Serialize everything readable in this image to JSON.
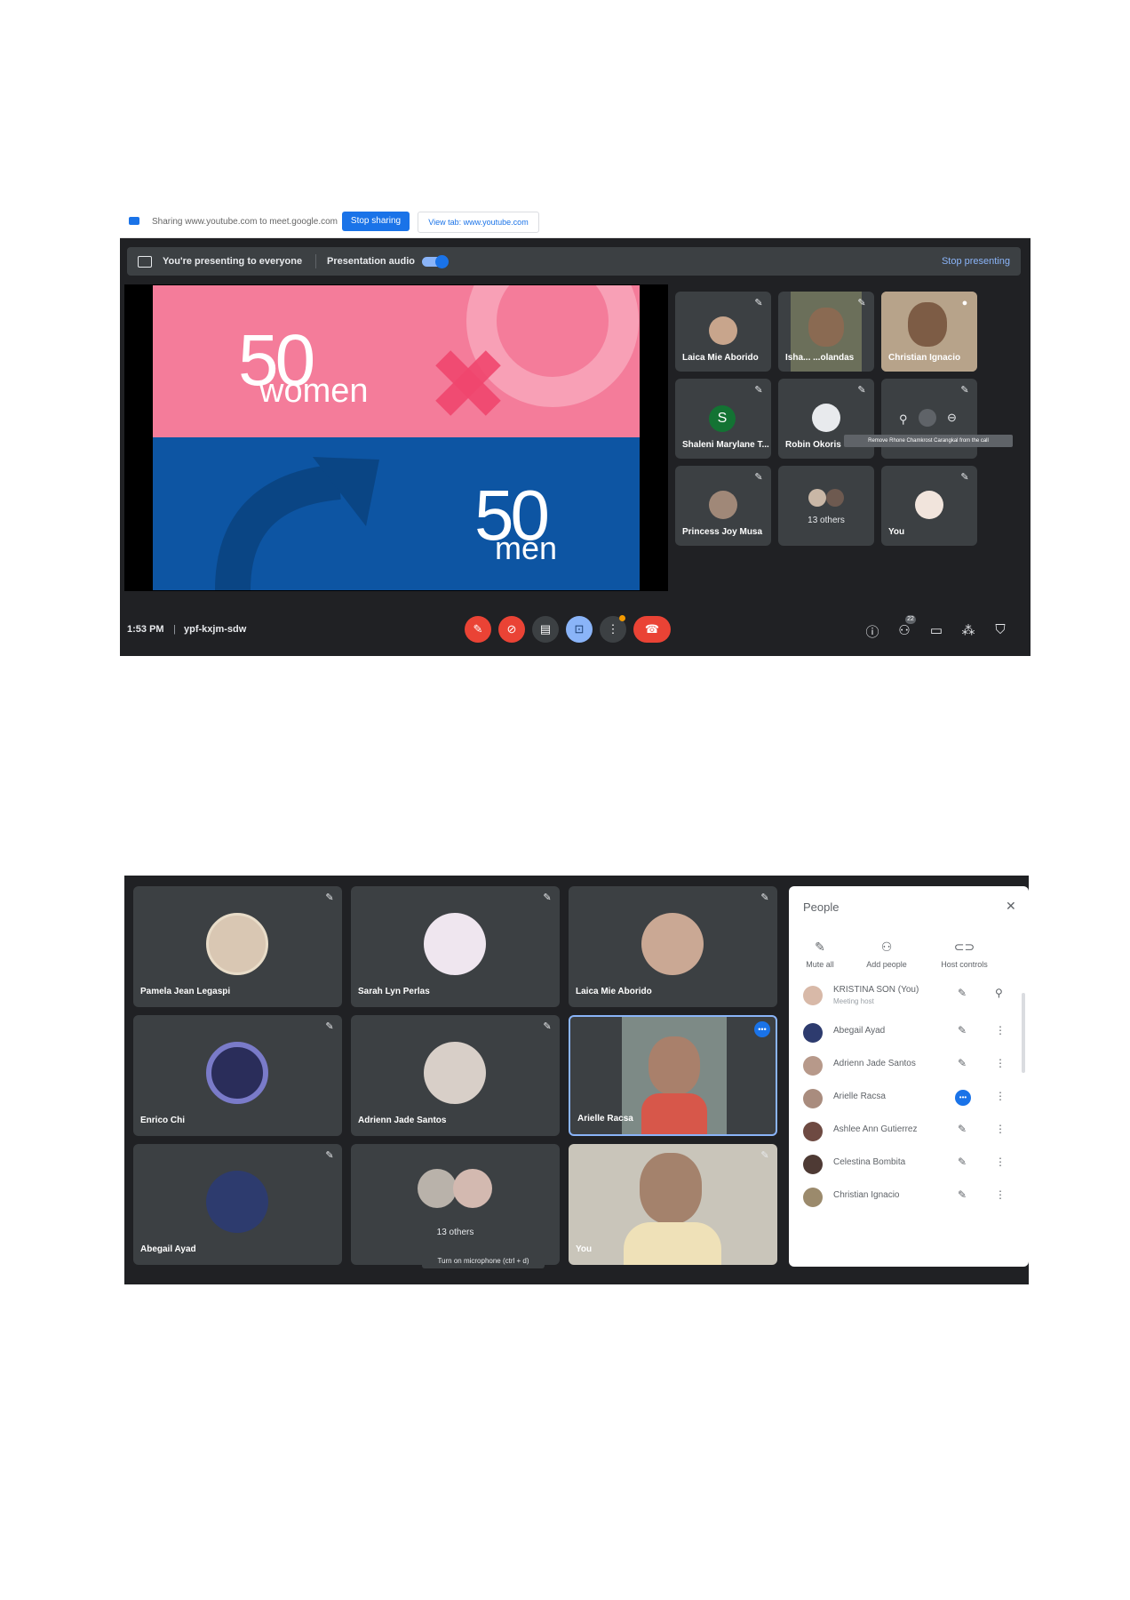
{
  "screenshot1": {
    "share_bar": {
      "text": "Sharing www.youtube.com to meet.google.com",
      "stop_sharing": "Stop sharing",
      "view_tab": "View tab: www.youtube.com"
    },
    "present_bar": {
      "presenting": "You're presenting to everyone",
      "audio": "Presentation audio",
      "stop": "Stop presenting"
    },
    "slide": {
      "top_number": "50",
      "top_word": "women",
      "bottom_number": "50",
      "bottom_word": "men",
      "top_color": "#f47c9a",
      "bottom_color": "#0d55a3"
    },
    "participants": [
      {
        "name": "Laica Mie Aborido"
      },
      {
        "name": "Isha... ...olandas"
      },
      {
        "name": "Christian Ignacio"
      },
      {
        "name": "Shaleni Marylane T...",
        "initial": "S"
      },
      {
        "name": "Robin Okoris"
      },
      {
        "name": ""
      },
      {
        "name": "Princess Joy Musa"
      },
      {
        "name": "13 others"
      },
      {
        "name": "You"
      }
    ],
    "tooltip": "Remove Rhone Chamkrost Carangkal from the call",
    "footer": {
      "time": "1:53 PM",
      "separator": "|",
      "code": "ypf-kxjm-sdw",
      "people_count": "22"
    },
    "icons": {
      "mic_off": "mic-off-icon",
      "cam_off": "camera-off-icon",
      "captions": "captions-icon",
      "present": "present-icon",
      "more": "more-vert-icon",
      "end_call": "end-call-icon",
      "info": "info-icon",
      "people": "people-icon",
      "chat": "chat-icon",
      "activities": "activities-icon",
      "host": "host-controls-icon"
    }
  },
  "screenshot2": {
    "tiles": [
      {
        "name": "Pamela Jean Legaspi"
      },
      {
        "name": "Sarah Lyn Perlas"
      },
      {
        "name": "Laica Mie Aborido"
      },
      {
        "name": "Enrico Chi"
      },
      {
        "name": "Adrienn Jade Santos"
      },
      {
        "name": "Arielle Racsa"
      },
      {
        "name": "Abegail Ayad"
      },
      {
        "name": "13 others"
      },
      {
        "name": "You"
      }
    ],
    "mic_tooltip": "Turn on microphone (ctrl + d)",
    "people_panel": {
      "title": "People",
      "close": "✕",
      "mute_all": "Mute all",
      "add_people": "Add people",
      "host_controls": "Host controls",
      "host_name": "KRISTINA SON (You)",
      "host_role": "Meeting host",
      "list": [
        {
          "name": "Abegail Ayad"
        },
        {
          "name": "Adrienn Jade Santos"
        },
        {
          "name": "Arielle Racsa"
        },
        {
          "name": "Ashlee Ann Gutierrez"
        },
        {
          "name": "Celestina Bombita"
        },
        {
          "name": "Christian Ignacio"
        }
      ]
    }
  }
}
